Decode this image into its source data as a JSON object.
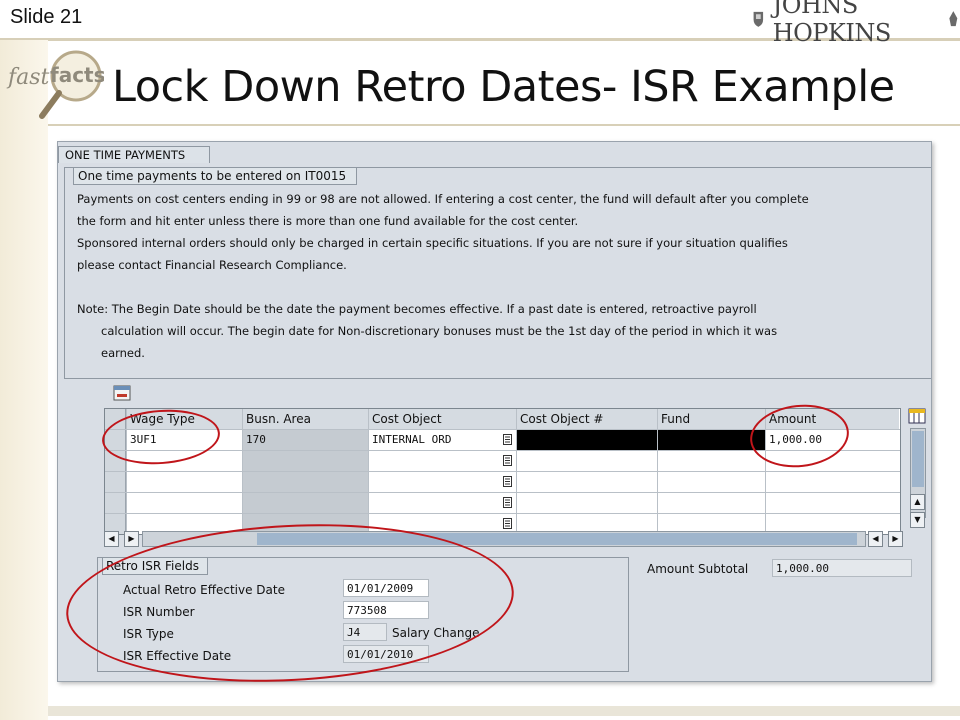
{
  "slide": {
    "number": "Slide 21",
    "title": "Lock Down Retro Dates- ISR Example",
    "logo_text": "JOHNS HOPKINS",
    "fastfacts_text": "fast facts"
  },
  "sap": {
    "tab_title": "ONE TIME PAYMENTS",
    "group_title": "One time payments to be entered on IT0015",
    "messages": [
      "Payments on cost centers ending in 99 or 98 are not allowed. If entering a cost center, the fund will default after you complete",
      "the form and hit enter unless there is more than one fund available for the cost center.",
      "Sponsored internal orders should only be charged in certain specific situations. If you are not sure if your situation qualifies",
      "please contact Financial Research Compliance.",
      "Note:  The Begin Date should be the date the payment becomes effective. If a past date is entered, retroactive payroll",
      "calculation will occur. The begin date for Non-discretionary bonuses must be the 1st day of the period in which it was",
      "earned."
    ],
    "table": {
      "headers": [
        "Wage Type",
        "Busn. Area",
        "Cost Object",
        "Cost Object #",
        "Fund",
        "Amount"
      ],
      "rows": [
        [
          "3UF1",
          "170",
          "INTERNAL ORD",
          "",
          "",
          "1,000.00"
        ],
        [
          "",
          "",
          "",
          "",
          "",
          ""
        ],
        [
          "",
          "",
          "",
          "",
          "",
          ""
        ],
        [
          "",
          "",
          "",
          "",
          "",
          ""
        ],
        [
          "",
          "",
          "",
          "",
          "",
          ""
        ]
      ]
    },
    "retro": {
      "title": "Retro ISR Fields",
      "effective_date_label": "Actual Retro Effective Date",
      "effective_date_value": "01/01/2009",
      "isr_number_label": "ISR Number",
      "isr_number_value": "773508",
      "isr_type_label": "ISR Type",
      "isr_type_value": "J4",
      "isr_type_text": "Salary Change",
      "isr_eff_label": "ISR Effective Date",
      "isr_eff_value": "01/01/2010"
    },
    "subtotal": {
      "label": "Amount Subtotal",
      "value": "1,000.00"
    }
  },
  "colors": {
    "annotation_red": "#c0151a",
    "sap_background": "#d9dee5"
  }
}
